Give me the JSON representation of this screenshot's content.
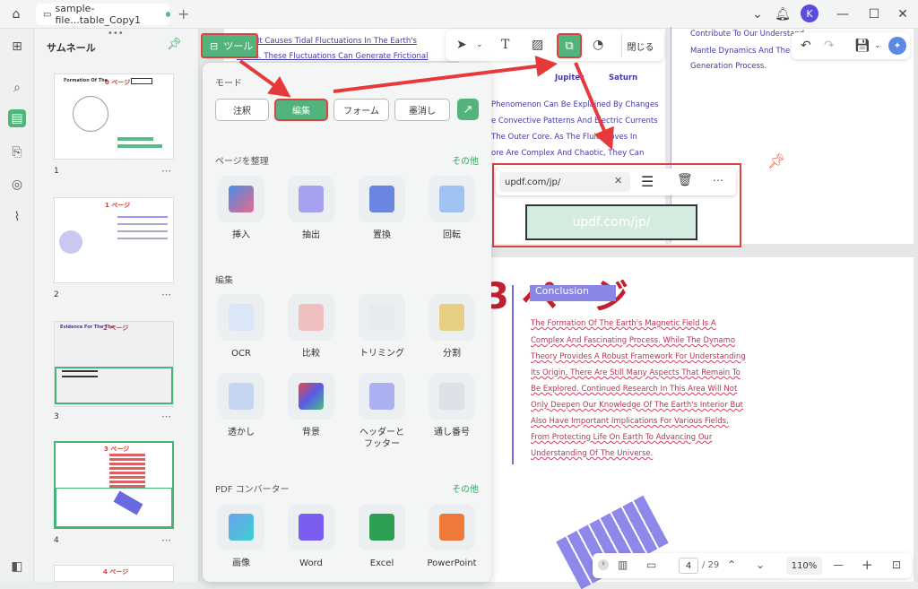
{
  "titlebar": {
    "tab_title": "sample-file...table_Copy1",
    "avatar": "K"
  },
  "sidebar": {
    "title": "サムネール",
    "pages": [
      "1",
      "2",
      "3",
      "4"
    ],
    "thumb_labels": [
      "0 ページ",
      "1 ページ",
      "2 ページ",
      "3 ページ",
      "4 ページ"
    ],
    "thumb_heading": "Formation Of The",
    "thumb3_heading": "Evidence For The The"
  },
  "tools_button": {
    "label": "ツール"
  },
  "panel": {
    "mode_title": "モード",
    "modes": [
      "注釈",
      "編集",
      "フォーム",
      "墨消し"
    ],
    "organize_title": "ページを整理",
    "more1": "その他",
    "organize": [
      "挿入",
      "抽出",
      "置換",
      "回転"
    ],
    "edit_title": "編集",
    "edit": [
      "OCR",
      "比較",
      "トリミング",
      "分割",
      "透かし",
      "背景",
      "ヘッダーと\nフッター",
      "通し番号"
    ],
    "convert_title": "PDF コンバーター",
    "more2": "その他",
    "convert": [
      "画像",
      "Word",
      "Excel",
      "PowerPoint"
    ]
  },
  "toolbar": {
    "close_label": "閉じる"
  },
  "link": {
    "url": "updf.com/jp/",
    "rect_text": "updf.com/jp/"
  },
  "doc": {
    "top_text": [
      "arth, It Causes Tidal Fluctuations In The Earth's",
      "ceans. These Fluctuations Can Generate Frictional"
    ],
    "right_text": [
      "Contribute To Our Understand",
      "Mantle Dynamics And The Ma",
      "Generation Process."
    ],
    "planets": [
      "Jupiter",
      "Saturn"
    ],
    "mid_text": [
      "Phenomenon Can Be Explained By Changes",
      "e Convective Patterns And Electric Currents",
      "The Outer Core. As The Fluid Moves In",
      "ore Are Complex And Chaotic, They Can"
    ],
    "page_label": "3 ページ",
    "badge": "Conclusion",
    "body": [
      "The Formation Of The Earth's Magnetic Field Is A",
      "Complex And Fascinating Process. While The Dynamo",
      "Theory Provides A Robust Framework For Understanding",
      "Its Origin, There Are Still Many Aspects That Remain To",
      "Be Explored. Continued Research In This Area Will Not",
      "Only Deepen Our Knowledge Of The Earth's Interior But",
      "Also Have Important Implications For Various Fields,",
      "From Protecting Life On Earth To Advancing Our",
      "Understanding Of The Universe."
    ]
  },
  "bottom": {
    "page_current": "4",
    "page_total": "/ 29",
    "zoom": "110%"
  },
  "colors": {
    "accent": "#52b47c",
    "highlight": "#e04040"
  }
}
